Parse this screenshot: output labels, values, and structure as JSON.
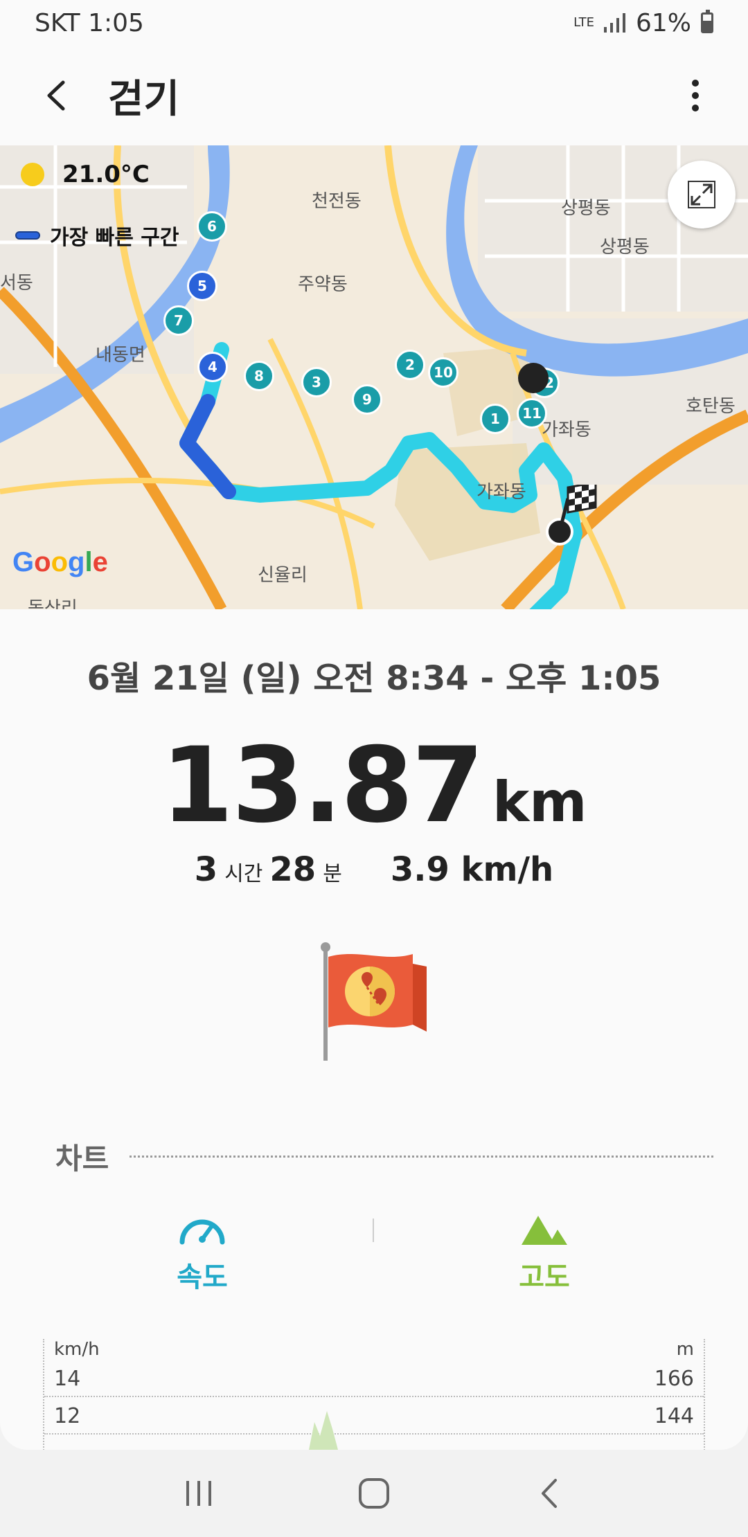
{
  "status_bar": {
    "carrier_time": "SKT 1:05",
    "network": "LTE",
    "battery": "61%"
  },
  "app_bar": {
    "title": "걷기",
    "back_icon": "back-arrow-icon",
    "more_icon": "more-vert-icon"
  },
  "map": {
    "temperature": "21.0°C",
    "legend_label": "가장 빠른 구간",
    "attribution": "Google",
    "place_labels": [
      "천전동",
      "상평동",
      "상평동",
      "주약동",
      "내동면",
      "호탄동",
      "가좌동",
      "신율리",
      "동산리",
      "서동",
      "가좌동"
    ],
    "km_markers": [
      "1",
      "2",
      "3",
      "4",
      "5",
      "6",
      "7",
      "8",
      "9",
      "10",
      "11",
      "12"
    ],
    "colors": {
      "route": "#2fd0e6",
      "fastest": "#2a62d9",
      "marker": "#1a9da8",
      "river": "#8ab4f2",
      "highway": "#f29e2c"
    }
  },
  "summary": {
    "date_range": "6월 21일 (일) 오전 8:34 - 오후 1:05",
    "distance_value": "13.87",
    "distance_unit": "km",
    "duration_hours": "3",
    "hours_unit": "시간",
    "duration_minutes": "28",
    "minutes_unit": "분",
    "avg_speed": "3.9 km/h"
  },
  "chart_section": {
    "title": "차트",
    "tabs": [
      {
        "label": "속도",
        "icon": "speedometer-icon",
        "color": "#21a9c9"
      },
      {
        "label": "고도",
        "icon": "mountain-icon",
        "color": "#86bf3b"
      }
    ],
    "left_unit": "km/h",
    "right_unit": "m",
    "rows": [
      {
        "left": "14",
        "right": "166"
      },
      {
        "left": "12",
        "right": "144"
      }
    ]
  },
  "nav_bar": {
    "recent_icon": "recent-apps-icon",
    "home_icon": "home-icon",
    "back_icon": "nav-back-icon"
  }
}
